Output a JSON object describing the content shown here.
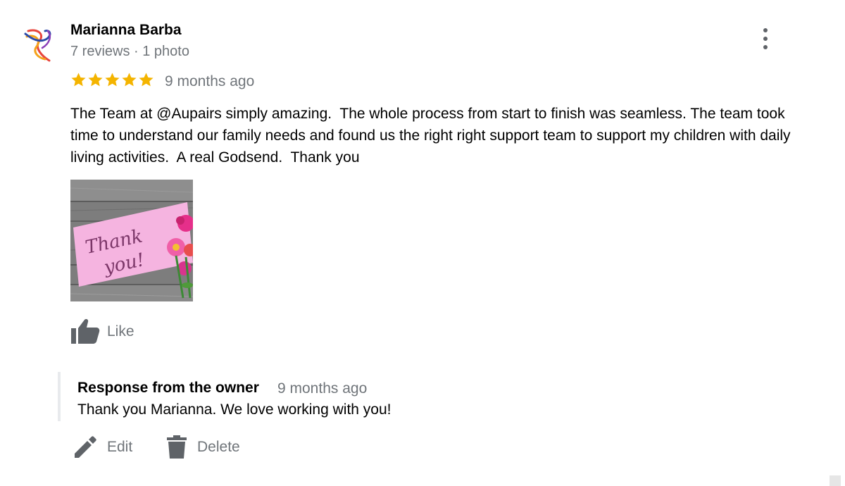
{
  "review": {
    "reviewer_name": "Marianna Barba",
    "reviewer_meta": "7 reviews · 1 photo",
    "rating": 5,
    "rating_max": 5,
    "time": "9 months ago",
    "text": "The Team at @Aupairs simply amazing.  The whole process from start to finish was seamless. The team took time to understand our family needs and found us the right right support team to support my children with daily living activities.  A real Godsend.  Thank you",
    "photo_text": "Thank you!",
    "like_label": "Like"
  },
  "owner_response": {
    "title": "Response from the owner",
    "time": "9 months ago",
    "text": "Thank you Marianna. We love working with you!"
  },
  "actions": {
    "edit_label": "Edit",
    "delete_label": "Delete"
  },
  "icons": {
    "avatar": "ribbon-logo-icon",
    "menu": "more-vert-icon",
    "star": "star-icon",
    "like": "thumbs-up-icon",
    "edit": "pencil-icon",
    "delete": "trash-icon"
  },
  "colors": {
    "star": "#f4b400",
    "muted_text": "#70757a",
    "icon_gray": "#5f6368",
    "photo_card": "#f5b4e0"
  }
}
